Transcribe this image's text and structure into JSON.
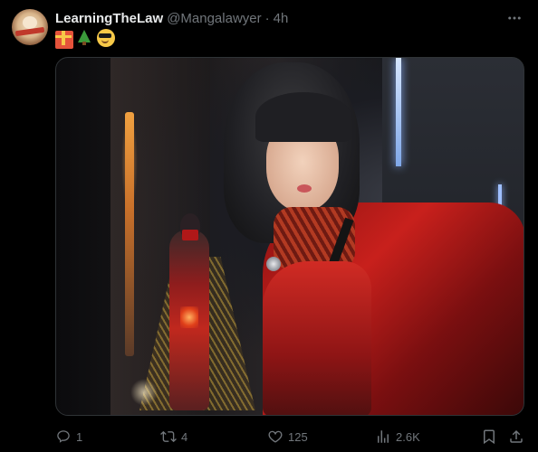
{
  "post": {
    "display_name": "LearningTheLaw",
    "handle": "@Mangalawyer",
    "separator": "·",
    "time": "4h",
    "emojis": [
      "gift-emoji",
      "christmas-tree-emoji",
      "sunglasses-emoji"
    ]
  },
  "media": {
    "alt": "image"
  },
  "actions": {
    "replies": "1",
    "reposts": "4",
    "likes": "125",
    "views": "2.6K"
  },
  "icons": {
    "more": "more-icon",
    "reply": "reply-icon",
    "repost": "repost-icon",
    "like": "heart-icon",
    "views": "views-icon",
    "bookmark": "bookmark-icon",
    "share": "share-icon"
  },
  "colors": {
    "background": "#000000",
    "text": "#e7e9ea",
    "muted": "#71767b",
    "border": "#2f3336"
  }
}
